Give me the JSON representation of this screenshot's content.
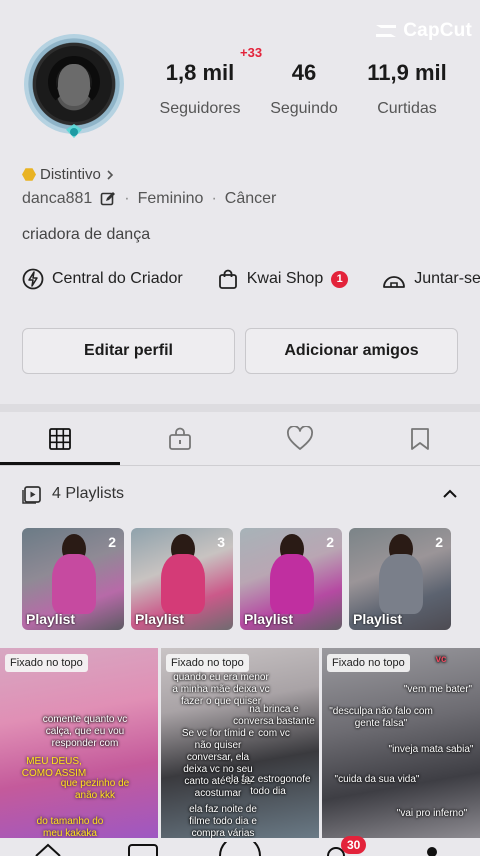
{
  "watermark": {
    "brand": "CapCut"
  },
  "profile": {
    "notification_increment": "+33",
    "stats": [
      {
        "value": "1,8 mil",
        "label": "Seguidores"
      },
      {
        "value": "46",
        "label": "Seguindo"
      },
      {
        "value": "11,9 mil",
        "label": "Curtidas"
      }
    ],
    "badge_label": "Distintivo",
    "username": "danca881",
    "gender": "Feminino",
    "sign": "Câncer",
    "bio": "criadora de dança"
  },
  "shortcuts": [
    {
      "label": "Central do Criador",
      "icon": "lightning-icon"
    },
    {
      "label": "Kwai Shop",
      "icon": "shopping-bag-icon",
      "badge": "1"
    },
    {
      "label": "Juntar-se",
      "icon": "dome-icon"
    }
  ],
  "actions": {
    "edit": "Editar perfil",
    "add_friends": "Adicionar amigos"
  },
  "tabs": [
    "grid-icon",
    "lock-bag-icon",
    "heart-icon",
    "bookmark-icon"
  ],
  "playlists": {
    "header": "4 Playlists",
    "items": [
      {
        "label": "Playlist",
        "count": "2",
        "color": "#c64aa0"
      },
      {
        "label": "Playlist",
        "count": "3",
        "color": "#d43b77"
      },
      {
        "label": "Playlist",
        "count": "2",
        "color": "#c02fa0"
      },
      {
        "label": "Playlist",
        "count": "2",
        "color": "#7a7f8a"
      }
    ]
  },
  "videos": [
    {
      "pinned": "Fixado no topo",
      "captions": [
        "comente quanto vc calça, que eu vou responder com",
        "MEU DEUS, COMO ASSIM",
        "que pezinho de anão kkk",
        "do tamanho do meu kakaka"
      ]
    },
    {
      "pinned": "Fixado no topo",
      "captions": [
        "quando eu era menor a minha mãe deixa vc fazer o que quiser",
        "na brinca e conversa bastante com vc",
        "Se vc for tímid e não quiser conversar, ela deixa vc no seu canto até vc se acostumar",
        "ela faz estrogonofe todo dia",
        "ela faz noite de filme todo dia e compra várias"
      ]
    },
    {
      "pinned": "Fixado no topo",
      "captions": [
        "vc",
        "\"vem me bater\"",
        "\"desculpa não falo com gente falsa\"",
        "\"inveja mata sabia\"",
        "\"cuida da sua vida\"",
        "\"vai pro inferno\""
      ]
    }
  ],
  "bottom_nav": {
    "notification_count": "30"
  }
}
